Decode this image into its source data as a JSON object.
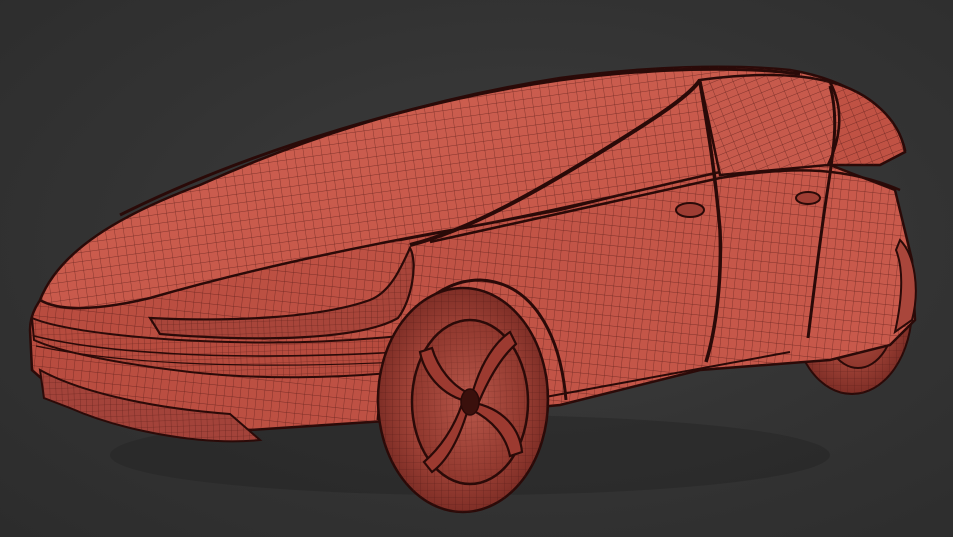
{
  "viewport": {
    "background": "#353535"
  },
  "model": {
    "subject": "car-wireframe",
    "shading": "wireframe-over-shaded",
    "surface_color": "#c9574a",
    "surface_light": "#d8685a",
    "surface_dark": "#9a3a31",
    "wire_color": "#4a1512",
    "edge_color": "#2a0a08"
  }
}
